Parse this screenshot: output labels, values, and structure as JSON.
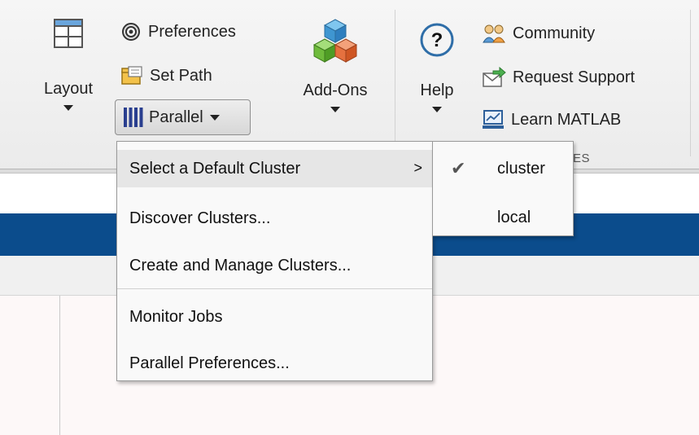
{
  "ribbon": {
    "layout_label": "Layout",
    "preferences_label": "Preferences",
    "set_path_label": "Set Path",
    "parallel_label": "Parallel",
    "addons_label": "Add-Ons",
    "help_label": "Help",
    "community_label": "Community",
    "request_support_label": "Request Support",
    "learn_matlab_label": "Learn MATLAB",
    "group_label_fragment": "ES"
  },
  "parallel_menu": {
    "items": [
      {
        "label": "Select a Default Cluster",
        "has_submenu": true,
        "highlighted": true
      },
      {
        "label": "Discover Clusters..."
      },
      {
        "label": "Create and Manage Clusters..."
      },
      {
        "label": "Monitor Jobs"
      },
      {
        "label": "Parallel Preferences..."
      }
    ],
    "submenu_arrow": ">"
  },
  "cluster_submenu": {
    "items": [
      {
        "label": "cluster",
        "checked": true,
        "check_glyph": "✔"
      },
      {
        "label": "local",
        "checked": false
      }
    ]
  },
  "colors": {
    "blue_bar": "#0b4c8c",
    "menu_bg": "#f9f9f9",
    "highlight": "#e6e6e6"
  },
  "icons": [
    "layout-icon",
    "gear-icon",
    "folder-path-icon",
    "parallel-bars-icon",
    "addons-cubes-icon",
    "help-icon",
    "community-icon",
    "request-support-icon",
    "learn-matlab-icon",
    "check-icon",
    "chevron-right-icon"
  ]
}
